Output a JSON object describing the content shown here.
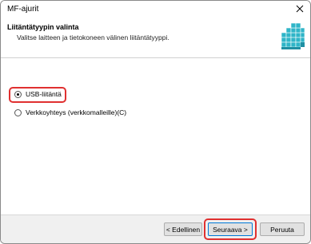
{
  "window": {
    "title": "MF-ajurit"
  },
  "header": {
    "title": "Liitäntätyypin valinta",
    "subtitle": "Valitse laitteen ja tietokoneen välinen liitäntätyyppi."
  },
  "options": [
    {
      "label": "USB-liitäntä",
      "selected": true
    },
    {
      "label": "Verkkoyhteys (verkkomalleille)(C)",
      "selected": false
    }
  ],
  "buttons": {
    "back": "< Edellinen",
    "next": "Seuraava >",
    "cancel": "Peruuta"
  },
  "colors": {
    "highlight": "#e03030",
    "icon_cube": "#2fb5c8"
  }
}
